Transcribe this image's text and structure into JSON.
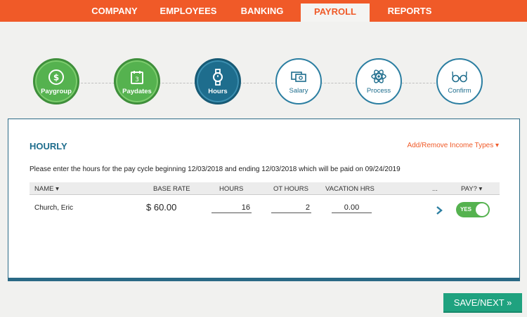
{
  "topnav": {
    "tabs": [
      {
        "label": "COMPANY"
      },
      {
        "label": "EMPLOYEES"
      },
      {
        "label": "BANKING"
      },
      {
        "label": "PAYROLL"
      },
      {
        "label": "REPORTS"
      }
    ],
    "active": "PAYROLL"
  },
  "steps": [
    {
      "label": "Paygroup",
      "state": "done",
      "icon": "dollar-coin-icon"
    },
    {
      "label": "Paydates",
      "state": "done",
      "icon": "calendar-icon"
    },
    {
      "label": "Hours",
      "state": "current",
      "icon": "watch-icon"
    },
    {
      "label": "Salary",
      "state": "todo",
      "icon": "money-icon"
    },
    {
      "label": "Process",
      "state": "todo",
      "icon": "atom-icon"
    },
    {
      "label": "Confirm",
      "state": "todo",
      "icon": "glasses-icon"
    }
  ],
  "panel": {
    "title": "HOURLY",
    "add_remove": "Add/Remove Income Types ▾",
    "instructions": {
      "prefix": "Please enter the hours for the pay cycle beginning ",
      "begin": "12/03/2018",
      "mid": " and ending ",
      "end": "12/03/2018",
      "mid2": " which will be paid on ",
      "paid": "09/24/2019"
    },
    "columns": {
      "name": "NAME ▾",
      "base_rate": "BASE RATE",
      "hours": "HOURS",
      "ot_hours": "OT HOURS",
      "vacation": "VACATION HRS",
      "more": "...",
      "pay": "PAY? ▾"
    },
    "rows": [
      {
        "name": "Church, Eric",
        "base_rate": "$ 60.00",
        "hours": "16",
        "ot_hours": "2",
        "vacation": "0.00",
        "pay": "YES"
      }
    ]
  },
  "save_button": "SAVE/NEXT »",
  "colors": {
    "accent": "#f05a28",
    "done": "#55b24f",
    "primary": "#1e6d8d",
    "save": "#1fa27f"
  }
}
